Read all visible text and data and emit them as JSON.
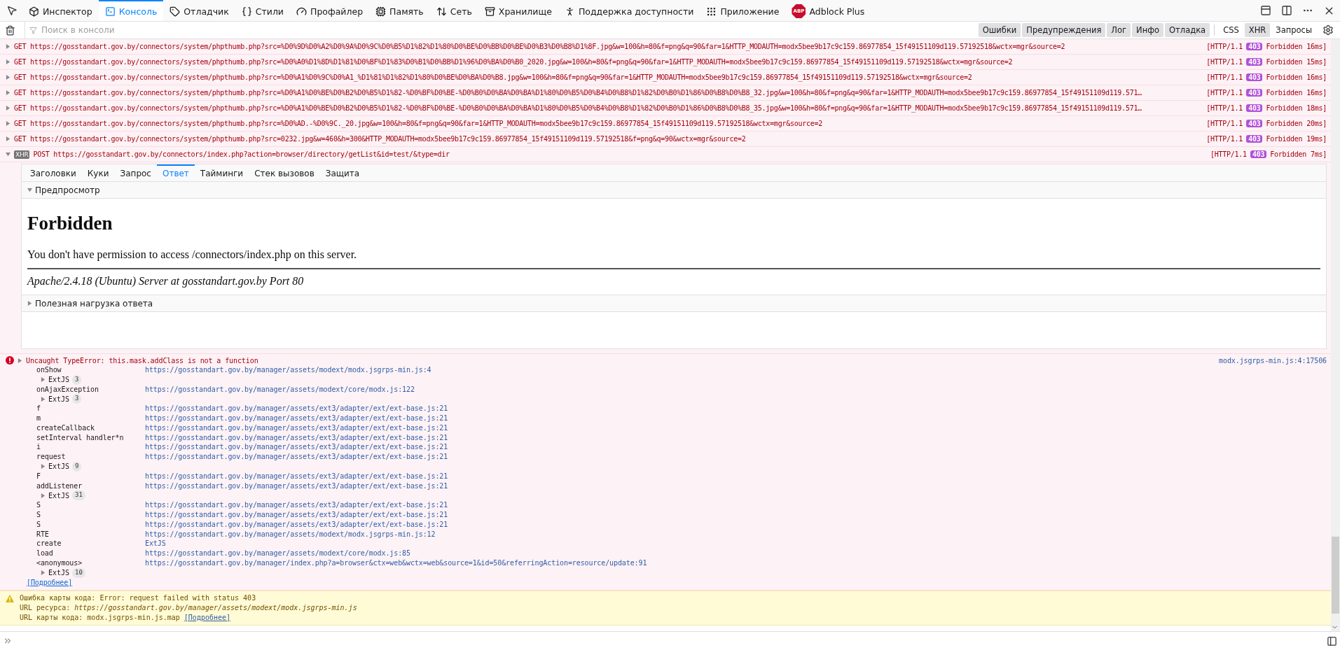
{
  "toolbar": {
    "tabs": [
      {
        "label": "Инспектор",
        "selected": false
      },
      {
        "label": "Консоль",
        "selected": true
      },
      {
        "label": "Отладчик",
        "selected": false
      },
      {
        "label": "Стили",
        "selected": false
      },
      {
        "label": "Профайлер",
        "selected": false
      },
      {
        "label": "Память",
        "selected": false
      },
      {
        "label": "Сеть",
        "selected": false
      },
      {
        "label": "Хранилище",
        "selected": false
      },
      {
        "label": "Поддержка доступности",
        "selected": false
      },
      {
        "label": "Приложение",
        "selected": false
      }
    ],
    "extension": {
      "logo_text": "ABP",
      "label": "Adblock Plus",
      "selected": false
    }
  },
  "filter_bar": {
    "placeholder": "Поиск в консоли",
    "levels": [
      {
        "label": "Ошибки",
        "selected": true
      },
      {
        "label": "Предупреждения",
        "selected": true
      },
      {
        "label": "Лог",
        "selected": true
      },
      {
        "label": "Инфо",
        "selected": true
      },
      {
        "label": "Отладка",
        "selected": true
      }
    ],
    "request_filters": [
      {
        "label": "CSS",
        "selected": false
      },
      {
        "label": "XHR",
        "selected": true
      },
      {
        "label": "Запросы",
        "selected": false
      }
    ]
  },
  "requests": [
    {
      "expanded": false,
      "method": "GET",
      "url": "https://gosstandart.gov.by/connectors/system/phpthumb.php?src=%D0%9D%D0%A2%D0%9A%D0%9C%D0%B5%D1%82%D1%80%D0%BE%D0%BB%D0%BE%D0%B3%D0%B8%D1%8F.jpg&w=100&h=80&f=png&q=90&far=1&HTTP_MODAUTH=modx5bee9b17c9c159.86977854_15f49151109d119.57192518&wctx=mgr&source=2",
      "protocol": "[HTTP/1.1",
      "status": "403",
      "result": "Forbidden 16ms]"
    },
    {
      "expanded": false,
      "method": "GET",
      "url": "https://gosstandart.gov.by/connectors/system/phpthumb.php?src=%D0%A0%D1%8D%D1%81%D0%BF%D1%83%D0%B1%D0%BB%D1%96%D0%BA%D0%B0_2020.jpg&w=100&h=80&f=png&q=90&far=1&HTTP_MODAUTH=modx5bee9b17c9c159.86977854_15f49151109d119.57192518&wctx=mgr&source=2",
      "protocol": "[HTTP/1.1",
      "status": "403",
      "result": "Forbidden 15ms]"
    },
    {
      "expanded": false,
      "method": "GET",
      "url": "https://gosstandart.gov.by/connectors/system/phpthumb.php?src=%D0%A1%D0%9C%D0%A1_%D1%81%D1%82%D1%80%D0%BE%D0%BA%D0%B8.jpg&w=100&h=80&f=png&q=90&far=1&HTTP_MODAUTH=modx5bee9b17c9c159.86977854_15f49151109d119.57192518&wctx=mgr&source=2",
      "protocol": "[HTTP/1.1",
      "status": "403",
      "result": "Forbidden 16ms]"
    },
    {
      "expanded": false,
      "method": "GET",
      "url": "https://gosstandart.gov.by/connectors/system/phpthumb.php?src=%D0%A1%D0%BE%D0%B2%D0%B5%D1%82-%D0%BF%D0%BE-%D0%B0%D0%BA%D0%BA%D1%80%D0%B5%D0%B4%D0%B8%D1%82%D0%B0%D1%86%D0%B8%D0%B8_32.jpg&w=100&h=80&f=png&q=90&far=1&HTTP_MODAUTH=modx5bee9b17c9c159.86977854_15f49151109d119.571…",
      "protocol": "[HTTP/1.1",
      "status": "403",
      "result": "Forbidden 16ms]"
    },
    {
      "expanded": false,
      "method": "GET",
      "url": "https://gosstandart.gov.by/connectors/system/phpthumb.php?src=%D0%A1%D0%BE%D0%B2%D0%B5%D1%82-%D0%BF%D0%BE-%D0%B0%D0%BA%D0%BA%D1%80%D0%B5%D0%B4%D0%B8%D1%82%D0%B0%D1%86%D0%B8%D0%B8_35.jpg&w=100&h=80&f=png&q=90&far=1&HTTP_MODAUTH=modx5bee9b17c9c159.86977854_15f49151109d119.571…",
      "protocol": "[HTTP/1.1",
      "status": "403",
      "result": "Forbidden 18ms]"
    },
    {
      "expanded": false,
      "method": "GET",
      "url": "https://gosstandart.gov.by/connectors/system/phpthumb.php?src=%D0%AD.-%D0%9C._20.jpg&w=100&h=80&f=png&q=90&far=1&HTTP_MODAUTH=modx5bee9b17c9c159.86977854_15f49151109d119.57192518&wctx=mgr&source=2",
      "protocol": "[HTTP/1.1",
      "status": "403",
      "result": "Forbidden 20ms]"
    },
    {
      "expanded": false,
      "method": "GET",
      "url": "https://gosstandart.gov.by/connectors/system/phpthumb.php?src=0232.jpg&w=460&h=300&HTTP_MODAUTH=modx5bee9b17c9c159.86977854_15f49151109d119.57192518&f=png&q=90&wctx=mgr&source=2",
      "protocol": "[HTTP/1.1",
      "status": "403",
      "result": "Forbidden 19ms]"
    },
    {
      "expanded": true,
      "badge": "XHR",
      "method": "POST",
      "url": "https://gosstandart.gov.by/connectors/index.php?action=browser/directory/getList&id=test/&type=dir",
      "protocol": "[HTTP/1.1",
      "status": "403",
      "result": "Forbidden 7ms]",
      "details": {
        "tabs": [
          {
            "label": "Заголовки",
            "selected": false
          },
          {
            "label": "Куки",
            "selected": false
          },
          {
            "label": "Запрос",
            "selected": false
          },
          {
            "label": "Ответ",
            "selected": true
          },
          {
            "label": "Тайминги",
            "selected": false
          },
          {
            "label": "Стек вызовов",
            "selected": false
          },
          {
            "label": "Защита",
            "selected": false
          }
        ],
        "preview": {
          "title": "Предпросмотр",
          "expanded": true,
          "heading": "Forbidden",
          "paragraph": "You don't have permission to access /connectors/index.php on this server.",
          "address": "Apache/2.4.18 (Ubuntu) Server at gosstandart.gov.by Port 80"
        },
        "payload": {
          "title": "Полезная нагрузка ответа",
          "expanded": false
        }
      }
    }
  ],
  "error": {
    "expanded": false,
    "message": "Uncaught TypeError: this.mask.addClass is not a function",
    "source": "modx.jsgrps-min.js:4:17506",
    "frames": [
      {
        "kind": "frame",
        "function": "onShow",
        "location": "https://gosstandart.gov.by/manager/assets/modext/modx.jsgrps-min.js:4"
      },
      {
        "kind": "group",
        "label": "ExtJS",
        "count": "3",
        "expanded": false
      },
      {
        "kind": "frame",
        "function": "onAjaxException",
        "location": "https://gosstandart.gov.by/manager/assets/modext/core/modx.js:122"
      },
      {
        "kind": "group",
        "label": "ExtJS",
        "count": "3",
        "expanded": false
      },
      {
        "kind": "frame",
        "function": "f",
        "location": "https://gosstandart.gov.by/manager/assets/ext3/adapter/ext/ext-base.js:21"
      },
      {
        "kind": "frame",
        "function": "m",
        "location": "https://gosstandart.gov.by/manager/assets/ext3/adapter/ext/ext-base.js:21"
      },
      {
        "kind": "frame",
        "function": "createCallback",
        "location": "https://gosstandart.gov.by/manager/assets/ext3/adapter/ext/ext-base.js:21"
      },
      {
        "kind": "frame",
        "function": "setInterval handler*n",
        "location": "https://gosstandart.gov.by/manager/assets/ext3/adapter/ext/ext-base.js:21"
      },
      {
        "kind": "frame",
        "function": "i",
        "location": "https://gosstandart.gov.by/manager/assets/ext3/adapter/ext/ext-base.js:21"
      },
      {
        "kind": "frame",
        "function": "request",
        "location": "https://gosstandart.gov.by/manager/assets/ext3/adapter/ext/ext-base.js:21"
      },
      {
        "kind": "group",
        "label": "ExtJS",
        "count": "9",
        "expanded": false
      },
      {
        "kind": "frame",
        "function": "F",
        "location": "https://gosstandart.gov.by/manager/assets/ext3/adapter/ext/ext-base.js:21"
      },
      {
        "kind": "frame",
        "function": "addListener",
        "location": "https://gosstandart.gov.by/manager/assets/ext3/adapter/ext/ext-base.js:21"
      },
      {
        "kind": "group",
        "label": "ExtJS",
        "count": "31",
        "expanded": false
      },
      {
        "kind": "frame",
        "function": "S",
        "location": "https://gosstandart.gov.by/manager/assets/ext3/adapter/ext/ext-base.js:21"
      },
      {
        "kind": "frame",
        "function": "S",
        "location": "https://gosstandart.gov.by/manager/assets/ext3/adapter/ext/ext-base.js:21"
      },
      {
        "kind": "frame",
        "function": "S",
        "location": "https://gosstandart.gov.by/manager/assets/ext3/adapter/ext/ext-base.js:21"
      },
      {
        "kind": "frame",
        "function": "RTE",
        "location": "https://gosstandart.gov.by/manager/assets/modext/modx.jsgrps-min.js:12"
      },
      {
        "kind": "frame",
        "function": "create",
        "location": "ExtJS"
      },
      {
        "kind": "frame",
        "function": "load",
        "location": "https://gosstandart.gov.by/manager/assets/modext/core/modx.js:85"
      },
      {
        "kind": "frame",
        "function": "<anonymous>",
        "location": "https://gosstandart.gov.by/manager/index.php?a=browser&ctx=web&wctx=web&source=1&id=50&referringAction=resource/update:91"
      },
      {
        "kind": "group",
        "label": "ExtJS",
        "count": "10",
        "expanded": false
      }
    ],
    "more": "[Подробнее]"
  },
  "warning": {
    "title": "Ошибка карты кода: Error: request failed with status 403",
    "resource_label": "URL ресурса:",
    "resource_url": "https://gosstandart.gov.by/manager/assets/modext/modx.jsgrps-min.js",
    "map_label": "URL карты кода:",
    "map_file": "modx.jsgrps-min.js.map",
    "more": "[Подробнее]"
  }
}
